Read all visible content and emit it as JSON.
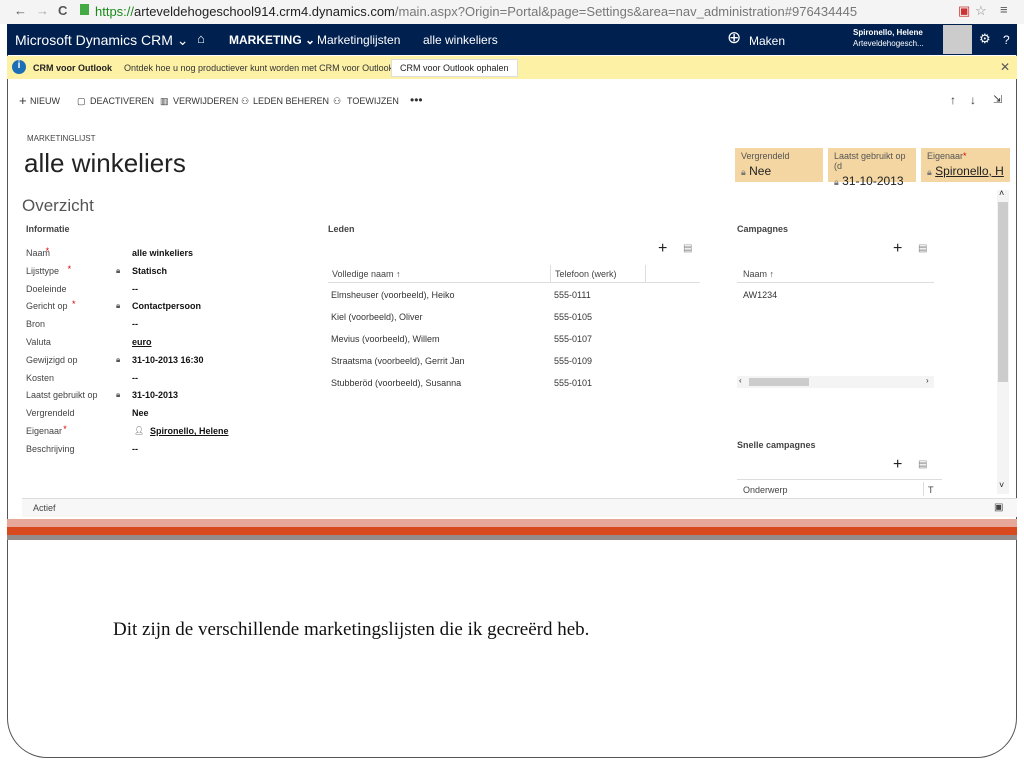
{
  "browser": {
    "url_secure": "https://",
    "url_host": "arteveldehogeschool914.crm4.dynamics.com",
    "url_path": "/main.aspx?Origin=Portal&page=Settings&area=nav_administration#976434445"
  },
  "nav": {
    "brand": "Microsoft Dynamics CRM ⌄",
    "area": "MARKETING ⌄",
    "entity": "Marketinglijsten",
    "record": "alle winkeliers",
    "create": "Maken",
    "user_name": "Spironello, Helene",
    "user_org": "Arteveldehogesch..."
  },
  "notification": {
    "title": "CRM voor Outlook",
    "text": "Ontdek hoe u nog productiever kunt worden met CRM voor Outlook.",
    "button": "CRM voor Outlook ophalen"
  },
  "commands": [
    "NIEUW",
    "DEACTIVEREN",
    "VERWIJDEREN",
    "LEDEN BEHEREN",
    "TOEWIJZEN"
  ],
  "header": {
    "entity_label": "MARKETINGLIJST",
    "title": "alle winkeliers",
    "tiles": [
      {
        "label": "Vergrendeld",
        "value": "Nee"
      },
      {
        "label": "Laatst gebruikt op (d",
        "value": "31-10-2013"
      },
      {
        "label": "Eigenaar",
        "value": "Spironello, H"
      }
    ]
  },
  "section": "Overzicht",
  "info": {
    "title": "Informatie",
    "fields": [
      {
        "label": "Naam",
        "req": true,
        "lock": false,
        "value": "alle winkeliers"
      },
      {
        "label": "Lijsttype",
        "req": true,
        "lock": true,
        "value": "Statisch"
      },
      {
        "label": "Doeleinde",
        "req": false,
        "lock": false,
        "value": "--"
      },
      {
        "label": "Gericht op",
        "req": true,
        "lock": true,
        "value": "Contactpersoon"
      },
      {
        "label": "Bron",
        "req": false,
        "lock": false,
        "value": "--"
      },
      {
        "label": "Valuta",
        "req": false,
        "lock": false,
        "value": "euro"
      },
      {
        "label": "Gewijzigd op",
        "req": false,
        "lock": true,
        "value": "31-10-2013  16:30"
      },
      {
        "label": "Kosten",
        "req": false,
        "lock": false,
        "value": "--"
      },
      {
        "label": "Laatst gebruikt op",
        "req": false,
        "lock": true,
        "value": "31-10-2013"
      },
      {
        "label": "Vergrendeld",
        "req": false,
        "lock": false,
        "value": "Nee"
      },
      {
        "label": "Eigenaar",
        "req": true,
        "lock": false,
        "value": "Spironello, Helene"
      },
      {
        "label": "Beschrijving",
        "req": false,
        "lock": false,
        "value": "--"
      }
    ]
  },
  "members": {
    "title": "Leden",
    "columns": [
      "Volledige naam ↑",
      "Telefoon (werk)"
    ],
    "rows": [
      [
        "Elmsheuser (voorbeeld), Heiko",
        "555-0111"
      ],
      [
        "Kiel (voorbeeld), Oliver",
        "555-0105"
      ],
      [
        "Mevius (voorbeeld), Willem",
        "555-0107"
      ],
      [
        "Straatsma (voorbeeld), Gerrit Jan",
        "555-0109"
      ],
      [
        "Stubberöd (voorbeeld), Susanna",
        "555-0101"
      ]
    ]
  },
  "campaigns": {
    "title": "Campagnes",
    "column": "Naam ↑",
    "rows": [
      "AW1234"
    ]
  },
  "quick_campaigns": {
    "title": "Snelle campagnes",
    "columns": [
      "Onderwerp",
      "T"
    ]
  },
  "status": "Actief",
  "caption": "Dit zijn de verschillende marketingslijsten die ik gecreërd heb."
}
